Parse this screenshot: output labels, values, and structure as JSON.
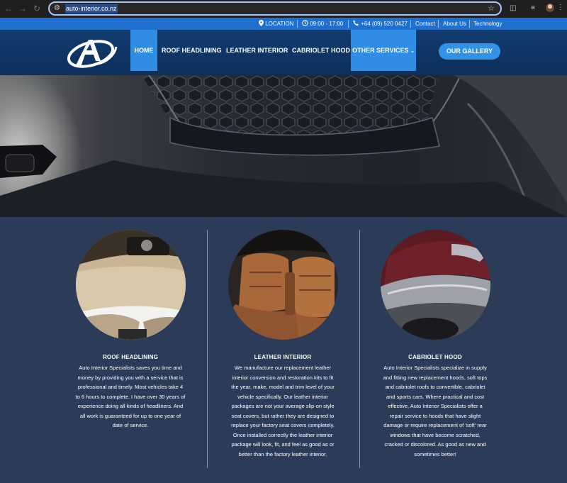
{
  "browser": {
    "url": "auto-interior.co.nz",
    "icons": {
      "back": "back-arrow-icon",
      "forward": "forward-arrow-icon",
      "reload": "reload-icon",
      "site_info": "tune-icon",
      "bookmark": "star-icon",
      "extensions": "puzzle-icon",
      "reading_list": "list-icon",
      "profile": "avatar",
      "menu": "kebab-menu-icon"
    }
  },
  "topbar": {
    "location": "LOCATION",
    "hours": "09:00 - 17:00",
    "phone": "+64 (09) 520 0427",
    "links": [
      "Contact",
      "About Us",
      "Technology"
    ]
  },
  "nav": {
    "items": [
      "HOME",
      "ROOF HEADLINING",
      "LEATHER INTERIOR",
      "CABRIOLET HOOD",
      "OTHER SERVICES"
    ],
    "active": "HOME",
    "gallery_button": "OUR GALLERY"
  },
  "services": [
    {
      "title": "ROOF HEADLINING",
      "lines": [
        "Auto Interior Specialists saves you time and",
        "money by providing you with a service that is",
        "professional and timely. Most vehicles take 4",
        "to 6 hours to complete. I have over 30 years of",
        "experience doing all kinds of headliners. And",
        "all work is guaranteed for up to one year of",
        "date of service."
      ]
    },
    {
      "title": "LEATHER INTERIOR",
      "lines": [
        "We manufacture our replacement leather",
        "interior conversion and restoration kits to fit",
        "the year, make, model and trim level of your",
        "vehicle specifically. Our leather interior",
        "packages are not your average slip-on style",
        "seat covers, but rather they are designed to",
        "replace your factory seat covers completely.",
        "Once installed correctly the leather interior",
        "package will look, fit, and feel as good as or",
        "better than the factory leather interior."
      ]
    },
    {
      "title": "CABRIOLET HOOD",
      "lines": [
        "Auto Interior Specialists specialize in supply",
        "and fitting new replacement hoods, soft tops",
        "and cabriolet roofs to convertible, cabriolet",
        "and sports cars. Where practical and cost",
        "effective, Auto Interior Specialists offer a",
        "repair service to hoods that have slight",
        "damage or require replacement of 'soft' rear",
        "windows that have become scratched,",
        "cracked or discolored. As good as new and",
        "sometimes better!"
      ]
    }
  ],
  "colors": {
    "topbar": "#1f6fd1",
    "nav_bg": "#123c70",
    "nav_active": "#2f8de4",
    "content_bg": "#2b3b58",
    "gallery_button": "#3292e8"
  }
}
